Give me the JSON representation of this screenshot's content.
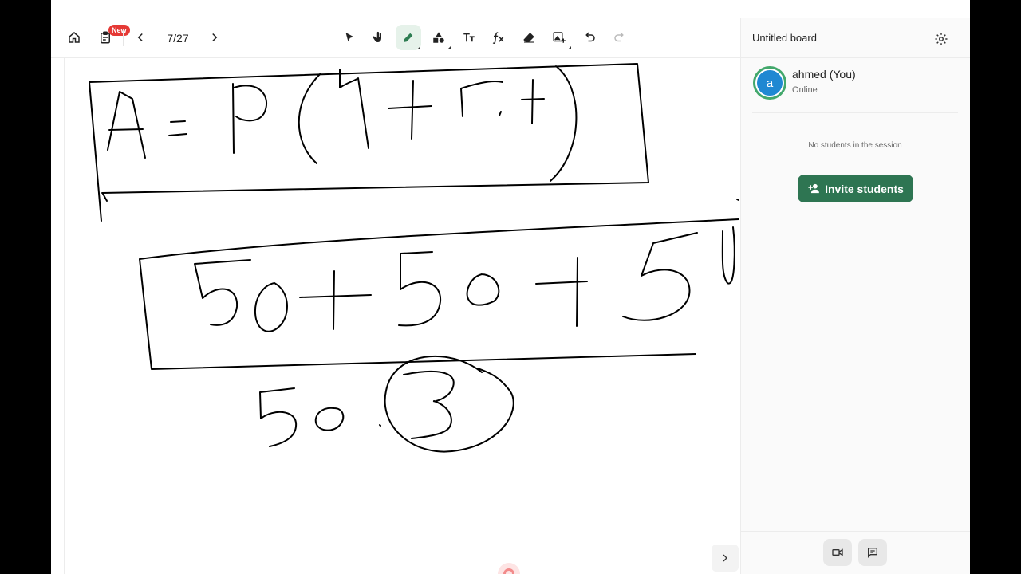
{
  "toolbar": {
    "new_badge": "New",
    "page_counter": "7/27",
    "icons": [
      "home-icon",
      "clipboard-icon",
      "chevron-left-icon",
      "chevron-right-icon",
      "select-arrow-icon",
      "hand-icon",
      "pen-icon",
      "shapes-icon",
      "text-icon",
      "formula-icon",
      "eraser-icon",
      "add-image-icon",
      "undo-icon",
      "redo-icon"
    ],
    "active_tool": "pen"
  },
  "sidepanel": {
    "board_title": "Untitled board",
    "user": {
      "avatar_letter": "a",
      "name": "ahmed (You)",
      "status": "Online"
    },
    "no_students_text": "No students in the session",
    "invite_label": "Invite students"
  },
  "colors": {
    "accent": "#2e7552",
    "avatar": "#1f88d2",
    "badge": "#e53935"
  }
}
